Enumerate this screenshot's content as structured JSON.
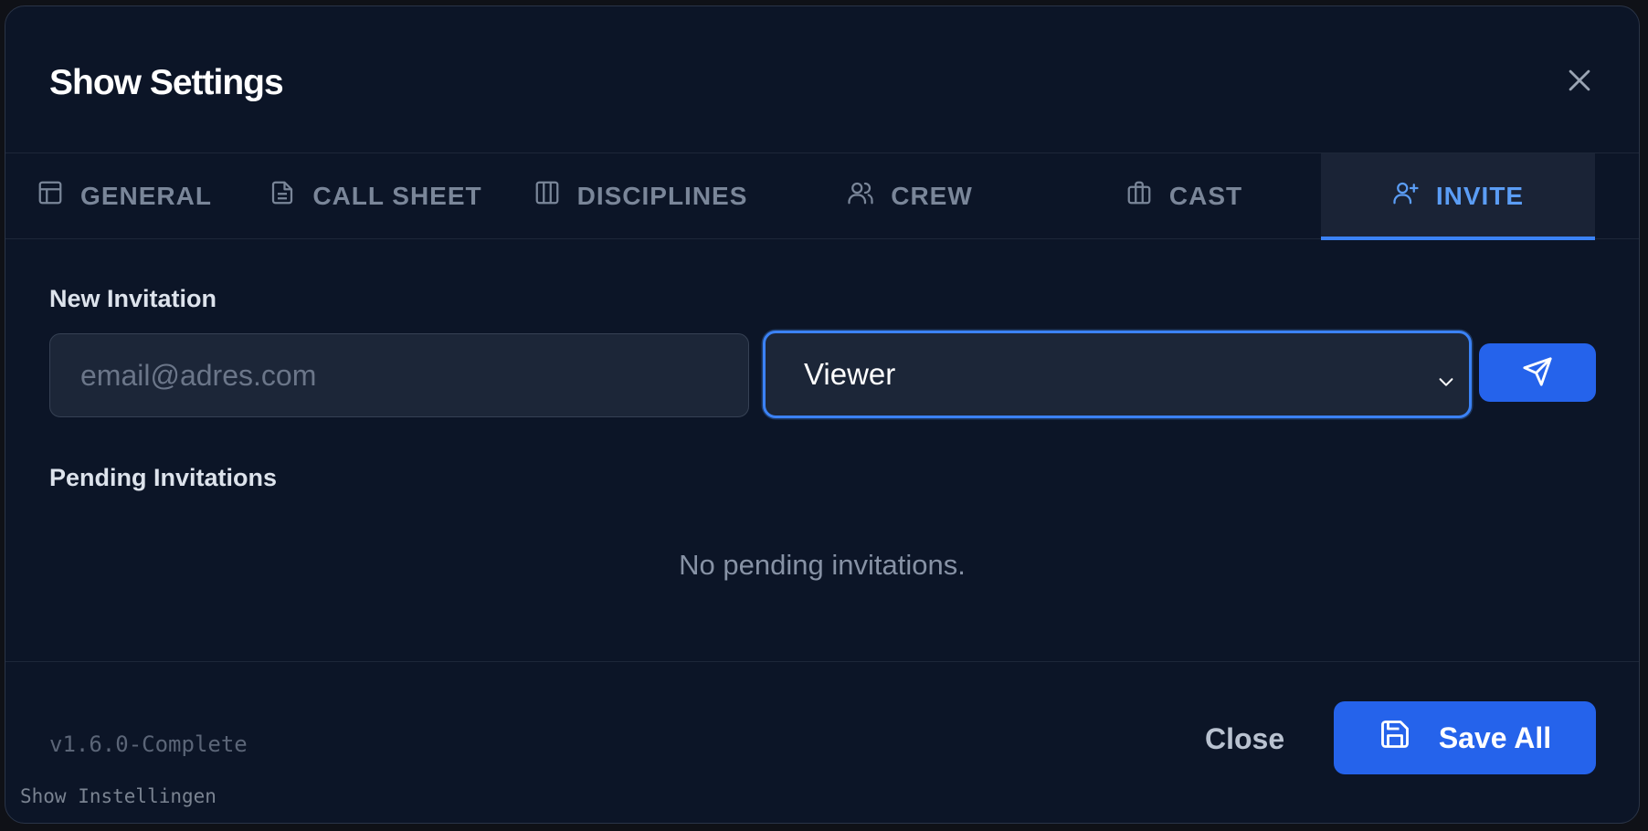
{
  "dialog": {
    "title": "Show Settings",
    "close_icon": "close-icon"
  },
  "tabs": [
    {
      "label": "GENERAL",
      "icon": "layout-icon",
      "active": false
    },
    {
      "label": "CALL SHEET",
      "icon": "document-icon",
      "active": false
    },
    {
      "label": "DISCIPLINES",
      "icon": "columns-icon",
      "active": false
    },
    {
      "label": "CREW",
      "icon": "users-icon",
      "active": false
    },
    {
      "label": "CAST",
      "icon": "briefcase-icon",
      "active": false
    },
    {
      "label": "INVITE",
      "icon": "user-plus-icon",
      "active": true
    }
  ],
  "invite": {
    "new_heading": "New Invitation",
    "email_placeholder": "email@adres.com",
    "email_value": "",
    "role_selected": "Viewer",
    "send_icon": "send-icon",
    "pending_heading": "Pending Invitations",
    "empty_message": "No pending invitations."
  },
  "footer": {
    "version": "v1.6.0-Complete",
    "subtitle": "Show Instellingen",
    "close_label": "Close",
    "save_label": "Save All",
    "save_icon": "save-icon"
  },
  "colors": {
    "background": "#0c1527",
    "accent": "#2563eb",
    "active_tab_text": "#5b9df5",
    "muted_text": "#7a8699"
  }
}
